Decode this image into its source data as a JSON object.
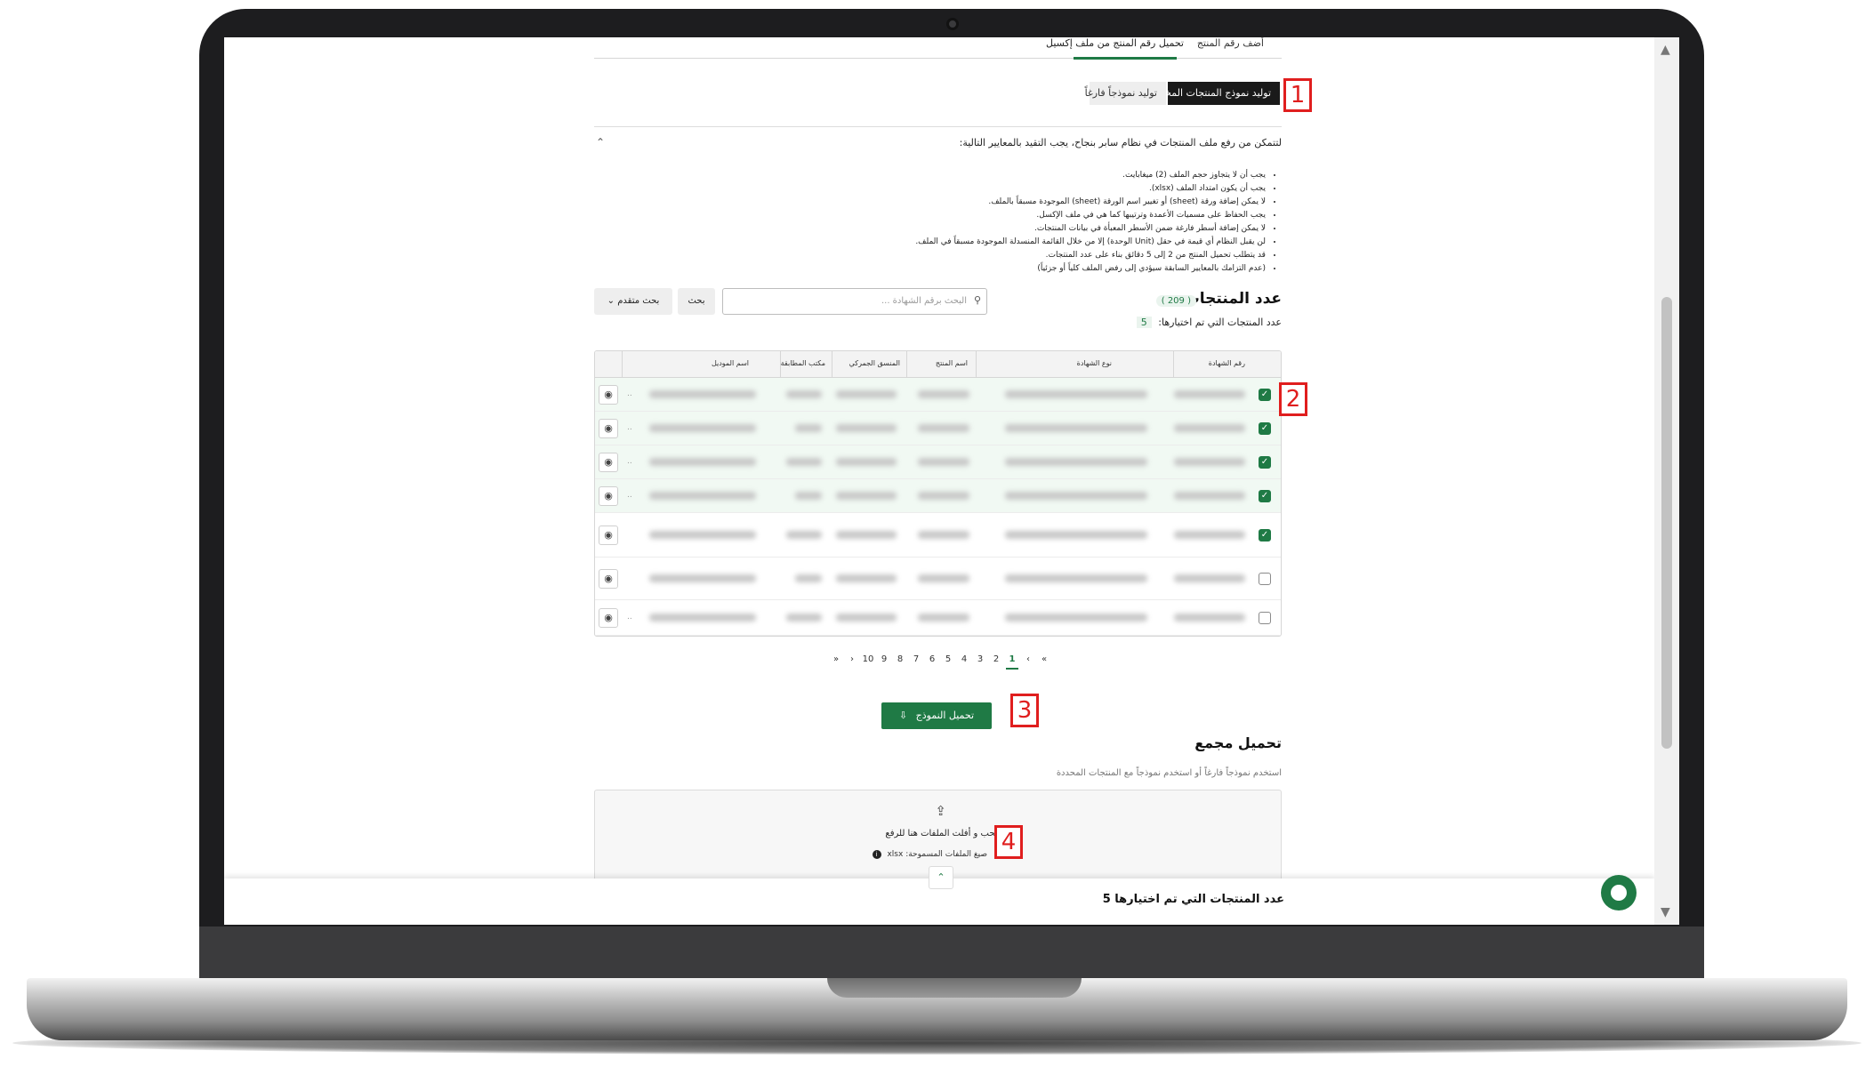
{
  "tabs": {
    "add_product_number": "أضف رقم المنتج",
    "upload_from_excel": "تحميل رقم المنتج من ملف إكسيل"
  },
  "generate": {
    "selected_template": "توليد نموذج المنتجات المختارة",
    "empty_template": "توليد نموذجاً فارغاً"
  },
  "criteria": {
    "title": "لتتمكن من رفع ملف المنتجات في نظام سابر بنجاح، يجب التقيد بالمعايير التالية:",
    "rules": [
      "يجب أن لا يتجاوز حجم الملف (2) ميغابايت.",
      "يجب أن يكون امتداد الملف (xlsx).",
      "لا يمكن إضافة ورقة (sheet) أو تغيير اسم الورقة (sheet) الموجودة مسبقاً بالملف.",
      "يجب الحفاظ على مسميات الأعمدة وترتيبها كما هي في ملف الإكسل.",
      "لا يمكن إضافة أسطر فارغة ضمن الأسطر المعبأة في بيانات المنتجات.",
      "لن يقبل النظام أي قيمة في حقل (Unit الوحدة) إلا من خلال القائمة المنسدلة الموجودة مسبقاً في الملف.",
      "قد يتطلب تحميل المنتج من 2 إلى 5 دقائق بناء على عدد المنتجات.",
      "(عدم التزامك بالمعايير السابقة سيؤدي إلى رفض الملف كلياً أو جزئياً)"
    ]
  },
  "products": {
    "title": "عدد المنتجات",
    "count": "( 209 )",
    "selected_label": "عدد المنتجات التي تم اختيارها:",
    "selected_count": "5"
  },
  "search": {
    "placeholder": "البحث برقم الشهادة ...",
    "search_button": "بحث",
    "advanced_button": "بحث متقدم"
  },
  "table": {
    "headers": [
      "رقم الشهادة",
      "نوع الشهادة",
      "اسم المنتج",
      "المنسق الجمركي",
      "مكتب المطابقة",
      "اسم الموديل"
    ],
    "rows": [
      {
        "checked": true
      },
      {
        "checked": true
      },
      {
        "checked": true
      },
      {
        "checked": true
      },
      {
        "checked": true
      },
      {
        "checked": false
      },
      {
        "checked": false
      }
    ]
  },
  "pagination": {
    "first": "«",
    "prev": "‹",
    "pages": [
      "1",
      "2",
      "3",
      "4",
      "5",
      "6",
      "7",
      "8",
      "9",
      "10"
    ],
    "next": "›",
    "last": "»",
    "current": "1"
  },
  "download": {
    "label": "تحميل النموذج"
  },
  "bulk_upload": {
    "title": "تحميل مجمع",
    "subtitle": "استخدم نموذجاً فارغاً أو استخدم نموذجاً مع المنتجات المحددة",
    "drop_text": "اسحب و أفلت الملفات هنا للرفع",
    "formats": "صيغ الملفات المسموحة: xlsx"
  },
  "footer": {
    "selected_summary": "عدد المنتجات التي تم اختيارها 5"
  },
  "markers": [
    "1",
    "2",
    "3",
    "4"
  ],
  "colors": {
    "primary_green": "#1f7a45",
    "marker_red": "#e01e1e",
    "dark_button": "#1a1a1a"
  },
  "icons": {
    "search": "search-icon",
    "view": "eye-icon",
    "upload": "upload-icon",
    "info": "info-icon",
    "chat": "chat-icon",
    "collapse": "chevron-up-icon"
  }
}
